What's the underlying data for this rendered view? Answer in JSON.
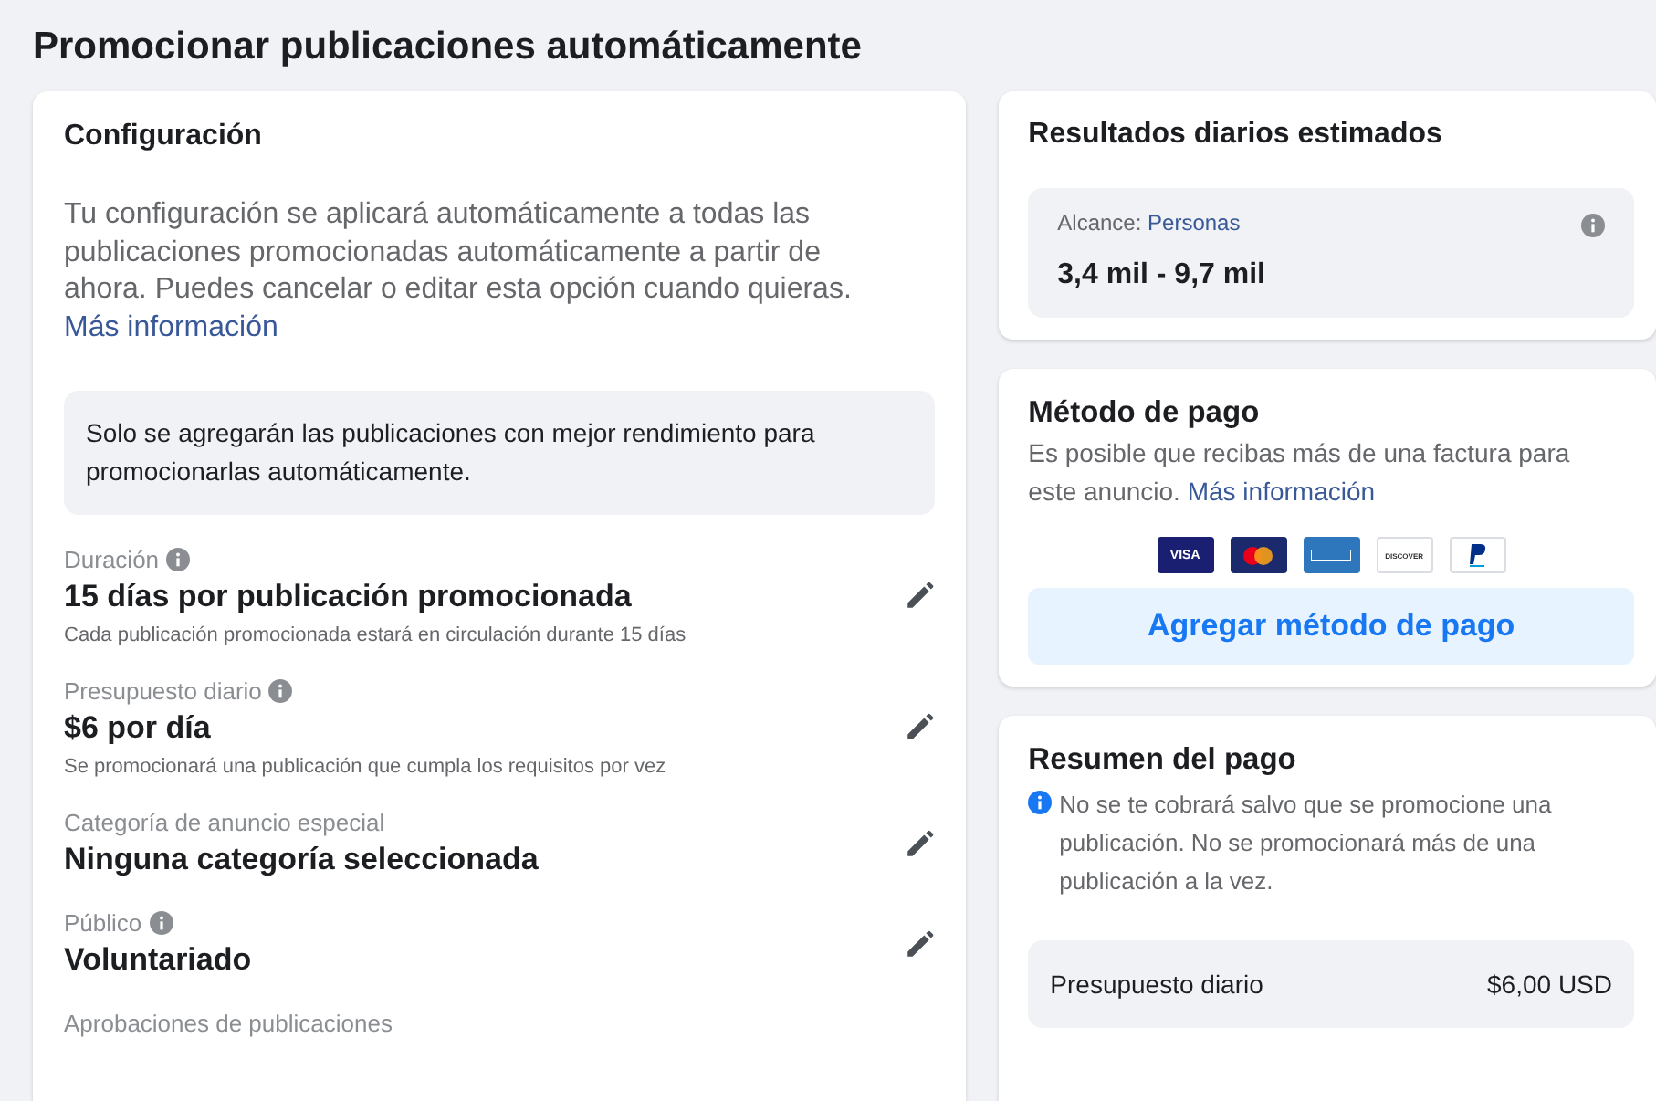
{
  "page": {
    "title": "Promocionar publicaciones automáticamente"
  },
  "configuration": {
    "heading": "Configuración",
    "description": "Tu configuración se aplicará automáticamente a todas las publicaciones promocionadas automáticamente a partir de ahora. Puedes cancelar o editar esta opción cuando quieras.",
    "link": "Más información",
    "notice": "Solo se agregarán las publicaciones con mejor rendimiento para promocionarlas automáticamente.",
    "settings": [
      {
        "label": "Duración",
        "info": true,
        "value": "15 días por publicación promocionada",
        "note": "Cada publicación promocionada estará en circulación durante 15 días",
        "editable": true
      },
      {
        "label": "Presupuesto diario",
        "info": true,
        "value": "$6 por día",
        "note": "Se promocionará una publicación que cumpla los requisitos por vez",
        "editable": true
      },
      {
        "label": "Categoría de anuncio especial",
        "info": false,
        "value": "Ninguna categoría seleccionada",
        "editable": true
      },
      {
        "label": "Público",
        "info": true,
        "value": "Voluntariado",
        "editable": true
      },
      {
        "label": "Aprobaciones de publicaciones",
        "info": false,
        "editable": false
      }
    ]
  },
  "estimated_results": {
    "heading": "Resultados diarios estimados",
    "reach_label": "Alcance:",
    "reach_link": "Personas",
    "reach_value": "3,4 mil - 9,7 mil"
  },
  "payment_method": {
    "heading": "Método de pago",
    "description": "Es posible que recibas más de una factura para este anuncio.",
    "link": "Más información",
    "cards": [
      {
        "kind": "visa",
        "label": "VISA"
      },
      {
        "kind": "mastercard"
      },
      {
        "kind": "amex"
      },
      {
        "kind": "discover",
        "label": "DISCOVER"
      },
      {
        "kind": "paypal"
      }
    ],
    "button": "Agregar método de pago"
  },
  "payment_summary": {
    "heading": "Resumen del pago",
    "notice": "No se te cobrará salvo que se promocione una publicación. No se promocionará más de una publicación a la vez.",
    "rows": [
      {
        "label": "Presupuesto diario",
        "value": "$6,00 USD"
      }
    ]
  }
}
